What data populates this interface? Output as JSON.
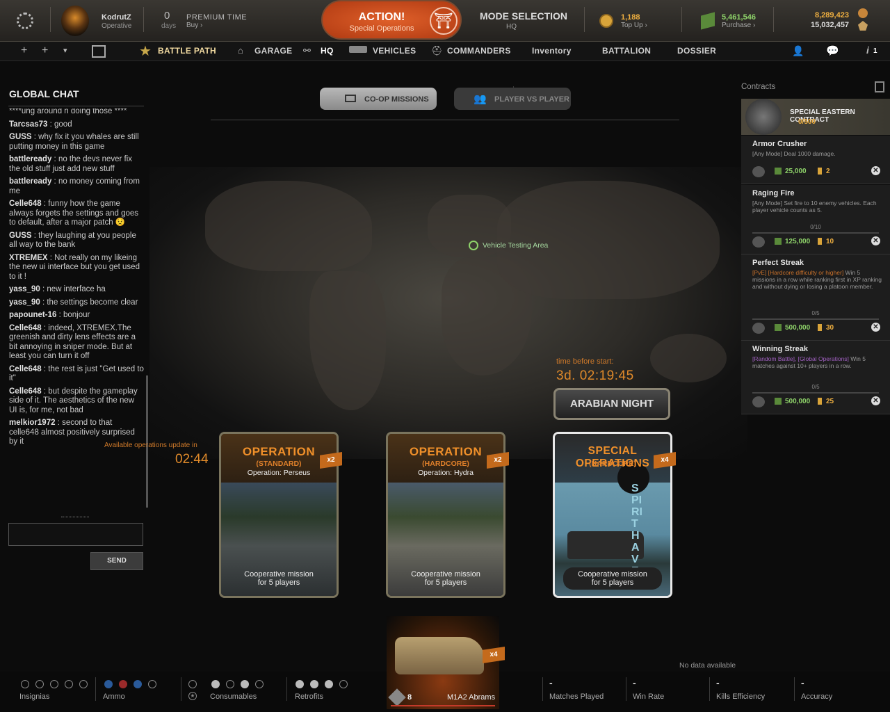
{
  "player": {
    "name": "KodrutZ",
    "rank": "Operative"
  },
  "premium": {
    "days_value": "0",
    "days_label": "days",
    "title": "PREMIUM TIME",
    "buy": "Buy"
  },
  "action": {
    "title": "ACTION!",
    "subtitle": "Special Operations"
  },
  "mode": {
    "title": "MODE SELECTION",
    "value": "HQ"
  },
  "currency": {
    "gold": "1,188",
    "gold_action": "Top Up",
    "credits": "5,461,546",
    "credits_action": "Purchase",
    "xp1": "8,289,423",
    "xp2": "15,032,457"
  },
  "nav": {
    "items": [
      "BATTLE PATH",
      "GARAGE",
      "HQ",
      "VEHICLES",
      "COMMANDERS",
      "Inventory",
      "BATTALION",
      "DOSSIER"
    ],
    "info_count": "1"
  },
  "chat": {
    "title": "GLOBAL CHAT",
    "send": "SEND",
    "input_value": "",
    "messages": [
      {
        "user": "",
        "text": "****ung around n doing those ****"
      },
      {
        "user": "Tarcsas73",
        "text": " : good"
      },
      {
        "user": "GUSS",
        "text": " : why fix it you whales are still putting money in this game"
      },
      {
        "user": "battleready",
        "text": " : no the devs never fix the old stuff just add new stuff"
      },
      {
        "user": "battleready",
        "text": " : no money coming from me"
      },
      {
        "user": "Celle648",
        "text": " : funny how the game always forgets the settings and goes to default, after a major patch 😟"
      },
      {
        "user": "GUSS",
        "text": " : they laughing at you people all way to the bank"
      },
      {
        "user": "XTREMEX",
        "text": " : Not really on my likeing the new ui interface but you get used to it !"
      },
      {
        "user": "yass_90",
        "text": " : new interface ha"
      },
      {
        "user": "yass_90",
        "text": " : the settings become clear"
      },
      {
        "user": "papounet-16",
        "text": " : bonjour"
      },
      {
        "user": "Celle648",
        "text": " : indeed, XTREMEX.The greenish and dirty lens effects are a bit annoying in sniper mode. But at least you can turn it off"
      },
      {
        "user": "Celle648",
        "text": " : the rest is just \"Get used to it\""
      },
      {
        "user": "Celle648",
        "text": " : but despite the gameplay side of it. The aesthetics of the new UI is, for me, not bad"
      },
      {
        "user": "melkior1972",
        "text": " : second to that celle648 almost positively surprised by it"
      }
    ]
  },
  "tabs": {
    "coop": "CO-OP MISSIONS",
    "pvp": "PLAYER VS PLAYER"
  },
  "map": {
    "marker": "Vehicle Testing Area",
    "update_label": "Available operations update in",
    "update_timer": "02:44",
    "time_before_label": "time before start:",
    "time_before": "3d. 02:19:45",
    "event": "ARABIAN NIGHT"
  },
  "cards": [
    {
      "title": "OPERATION",
      "difficulty": "(STANDARD)",
      "name": "Operation: Perseus",
      "mult": "x2",
      "desc1": "Cooperative mission",
      "desc2": "for 5 players"
    },
    {
      "title": "OPERATION",
      "difficulty": "(HARDCORE)",
      "name": "Operation: Hydra",
      "mult": "x2",
      "desc1": "Cooperative mission",
      "desc2": "for 5 players"
    },
    {
      "title": "SPECIAL OPERATIONS",
      "difficulty": "(HARDCORE)",
      "name": "",
      "mult": "x4",
      "desc1": "Cooperative mission",
      "desc2": "for 5 players",
      "art": "SPIRIT HAVEN"
    }
  ],
  "contracts": {
    "title": "Contracts",
    "special": {
      "name": "SPECIAL EASTERN CONTRACT",
      "progress": "0/500"
    },
    "items": [
      {
        "title": "Armor Crusher",
        "desc_tag": "",
        "desc": "[Any Mode] Deal 1000 damage.",
        "progress": "",
        "credits": "25,000",
        "gold": "2"
      },
      {
        "title": "Raging Fire",
        "desc_tag": "",
        "desc": "[Any Mode] Set fire to 10 enemy vehicles. Each player vehicle counts as 5.",
        "progress": "0/10",
        "credits": "125,000",
        "gold": "10"
      },
      {
        "title": "Perfect Streak",
        "desc_tag": "[PvE] [Hardcore difficulty or higher]",
        "desc": " Win 5 missions in a row while ranking first in XP ranking and without dying or losing a platoon member.",
        "progress": "0/5",
        "credits": "500,000",
        "gold": "30"
      },
      {
        "title": "Winning Streak",
        "desc_tag": "[Random Battle], [Global Operations]",
        "desc": " Win 5 matches against 10+ players in a row.",
        "progress": "0/5",
        "credits": "500,000",
        "gold": "25"
      }
    ]
  },
  "bottom": {
    "insignias": "Insignias",
    "ammo": "Ammo",
    "consumables": "Consumables",
    "retrofits": "Retrofits",
    "vehicle": {
      "tier": "8",
      "name": "M1A2 Abrams",
      "mult": "x4"
    },
    "no_data": "No data available",
    "stats": [
      {
        "value": "-",
        "label": "Matches Played"
      },
      {
        "value": "-",
        "label": "Win Rate"
      },
      {
        "value": "-",
        "label": "Kills Efficiency"
      },
      {
        "value": "-",
        "label": "Accuracy"
      }
    ]
  }
}
